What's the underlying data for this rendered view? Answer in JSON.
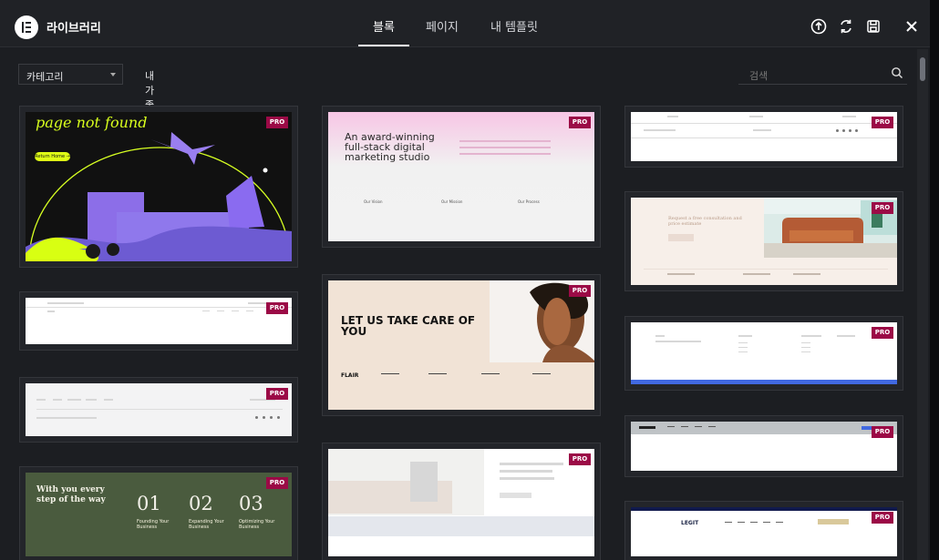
{
  "header": {
    "title": "라이브러리",
    "tabs": [
      "블록",
      "페이지",
      "내 템플릿"
    ],
    "active_tab": "블록"
  },
  "filters": {
    "category": "카테고리",
    "favorites": "내가 좋아하는 것들",
    "search_placeholder": "검색"
  },
  "cards": {
    "pro": "PRO",
    "c1": {
      "hero": "page not found",
      "button": "Return Home →"
    },
    "c2": {
      "headline": "An award-winning full-stack digital marketing studio",
      "a": "Our Vision",
      "b": "Our Mission",
      "c": "Our Process"
    },
    "c3": {
      "headline": "LET US TAKE CARE OF YOU",
      "brand": "FLAIR"
    },
    "c4": {
      "headline": "With you every step of the way",
      "n1": "01",
      "n2": "02",
      "n3": "03",
      "s1": "Founding Your Business",
      "s2": "Expanding Your Business",
      "s3": "Optimizing Your Business"
    },
    "c5": {
      "headline": "Request a free consultation and price estimate"
    },
    "c6": {
      "brand": "LEGIT"
    }
  },
  "colors": {
    "accent": "#9b0a46",
    "background": "#1c1e22",
    "header": "#202226"
  }
}
